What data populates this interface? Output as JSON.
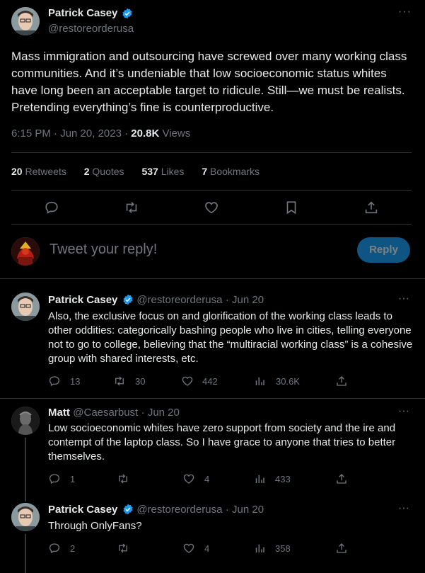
{
  "main_tweet": {
    "author_name": "Patrick Casey",
    "author_handle": "@restoreorderusa",
    "text": "Mass immigration and outsourcing have screwed over many working class communities. And it’s undeniable that low socioeconomic status whites have long been an acceptable target to ridicule. Still—we must be realists. Pretending everything’s fine is counterproductive.",
    "time": "6:15 PM · Jun 20, 2023 · ",
    "views_count": "20.8K",
    "views_label": " Views",
    "stats": {
      "retweets_count": "20",
      "retweets_label": "Retweets",
      "quotes_count": "2",
      "quotes_label": "Quotes",
      "likes_count": "537",
      "likes_label": "Likes",
      "bookmarks_count": "7",
      "bookmarks_label": "Bookmarks"
    }
  },
  "composer": {
    "placeholder": "Tweet your reply!",
    "reply_button": "Reply"
  },
  "replies": [
    {
      "author_name": "Patrick Casey",
      "author_handle": "@restoreorderusa",
      "date": "· Jun 20",
      "text": "Also, the exclusive focus on and glorification of the working class leads to other oddities: categorically bashing people who live in cities, telling everyone  not to go to college, believing that the “multiracial working class” is a cohesive group with shared interests, etc.",
      "replies": "13",
      "retweets": "30",
      "likes": "442",
      "views": "30.6K"
    },
    {
      "author_name": "Matt",
      "author_handle": "@Caesarbust",
      "date": "· Jun 20",
      "text": "Low socioeconomic whites have zero support from society and the ire and contempt of the laptop class.  So I have grace to anyone that tries to better themselves.",
      "replies": "1",
      "retweets": "",
      "likes": "4",
      "views": "433"
    },
    {
      "author_name": "Patrick Casey",
      "author_handle": "@restoreorderusa",
      "date": "· Jun 20",
      "text": "Through OnlyFans?",
      "replies": "2",
      "retweets": "",
      "likes": "4",
      "views": "358"
    }
  ],
  "colors": {
    "background": "#000000",
    "verified": "#1d9bf0",
    "accent": "#1d9bf0",
    "divider": "#2f3336"
  }
}
